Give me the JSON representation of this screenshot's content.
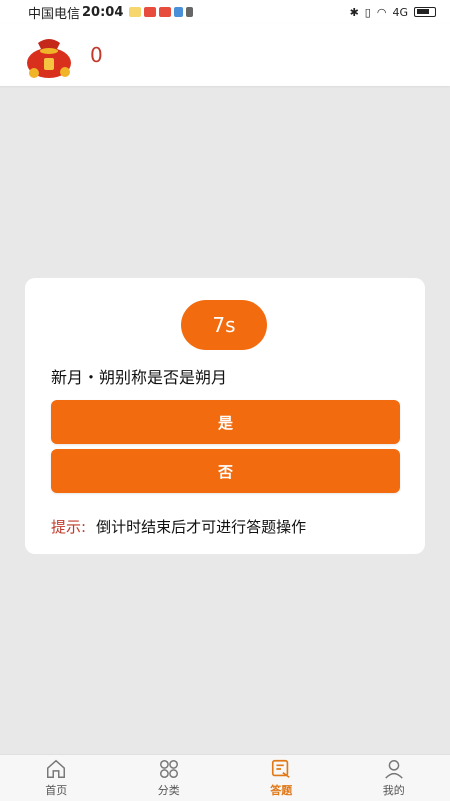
{
  "status_bar": {
    "carrier": "中国电信",
    "time": "20:04",
    "network": "4G"
  },
  "header": {
    "coin_count": "0",
    "icon": "money-bag-icon"
  },
  "quiz": {
    "timer": "7s",
    "question": "新月・朔别称是否是朔月",
    "answers": [
      "是",
      "否"
    ],
    "hint_label": "提示:",
    "hint_text": "倒计时结束后才可进行答题操作"
  },
  "tabs": [
    {
      "label": "首页",
      "icon": "home-icon",
      "active": false
    },
    {
      "label": "分类",
      "icon": "grid-icon",
      "active": false
    },
    {
      "label": "答题",
      "icon": "quiz-icon",
      "active": true
    },
    {
      "label": "我的",
      "icon": "user-icon",
      "active": false
    }
  ],
  "colors": {
    "accent": "#f26b0f",
    "hint_red": "#c0392b",
    "active_tab": "#e07818"
  }
}
